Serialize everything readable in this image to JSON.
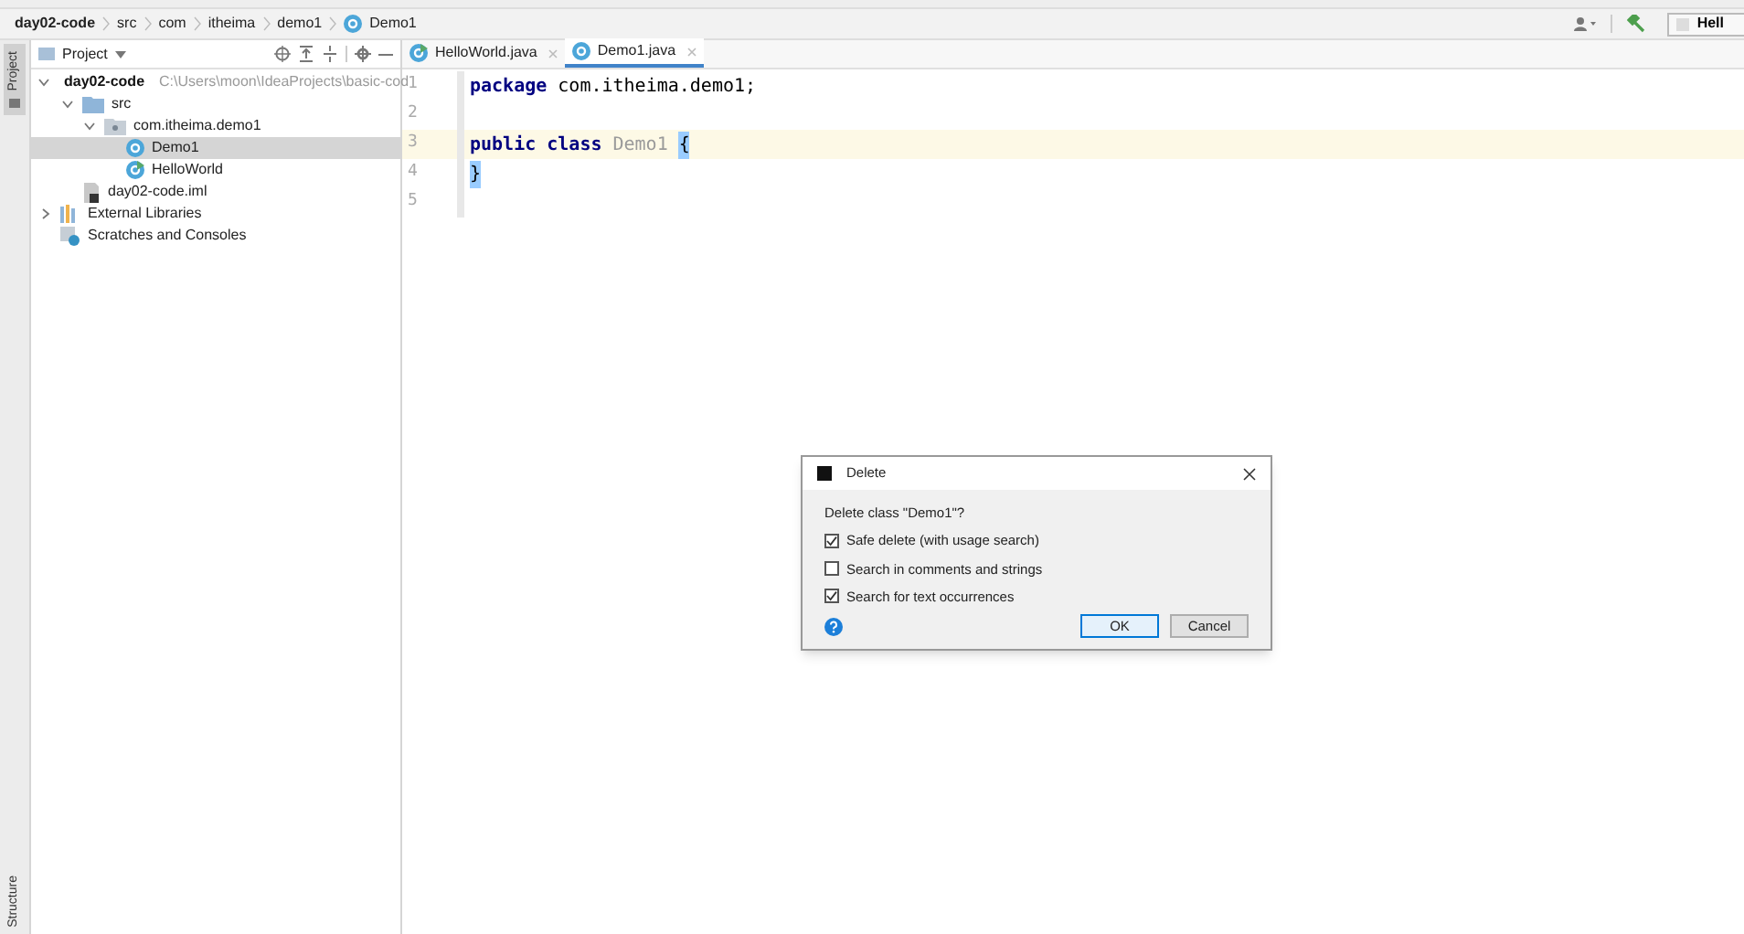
{
  "breadcrumbs": [
    {
      "label": "day02-code",
      "kind": "module"
    },
    {
      "label": "src",
      "kind": "folder"
    },
    {
      "label": "com",
      "kind": "folder"
    },
    {
      "label": "itheima",
      "kind": "folder"
    },
    {
      "label": "demo1",
      "kind": "folder"
    },
    {
      "label": "Demo1",
      "kind": "class"
    }
  ],
  "toolbar": {
    "run_config": "Hell"
  },
  "side_tabs": {
    "top": "Project",
    "bottom": "Structure"
  },
  "project_panel": {
    "title": "Project",
    "tree": [
      {
        "label": "day02-code",
        "path": "C:\\Users\\moon\\IdeaProjects\\basic-cod",
        "kind": "module",
        "expanded": true,
        "selected": false,
        "children": [
          {
            "label": "src",
            "kind": "folder",
            "expanded": true,
            "selected": false,
            "children": [
              {
                "label": "com.itheima.demo1",
                "kind": "package",
                "expanded": true,
                "selected": false,
                "children": [
                  {
                    "label": "Demo1",
                    "kind": "class",
                    "selected": true
                  },
                  {
                    "label": "HelloWorld",
                    "kind": "main",
                    "selected": false
                  }
                ]
              }
            ]
          },
          {
            "label": "day02-code.iml",
            "kind": "iml",
            "selected": false
          }
        ]
      },
      {
        "label": "External Libraries",
        "kind": "libs",
        "expanded": false,
        "selected": false
      },
      {
        "label": "Scratches and Consoles",
        "kind": "scratch",
        "selected": false
      }
    ]
  },
  "editor": {
    "tabs": [
      {
        "label": "HelloWorld.java",
        "kind": "main",
        "selected": false
      },
      {
        "label": "Demo1.java",
        "kind": "class",
        "selected": true
      }
    ],
    "lines": [
      {
        "number": "1",
        "current": false,
        "tokens": [
          {
            "text": "package",
            "kind": "keyword"
          },
          {
            "text": "com.itheima.demo1;",
            "kind": "plain"
          }
        ]
      },
      {
        "number": "2",
        "current": false
      },
      {
        "number": "3",
        "current": true,
        "tokens": [
          {
            "text": "public class",
            "kind": "keyword"
          },
          {
            "text": "Demo1",
            "kind": "unused"
          },
          {
            "text": "{",
            "kind": "brace"
          }
        ]
      },
      {
        "number": "4",
        "current": false,
        "tokens": [
          {
            "text": "}",
            "kind": "brace"
          }
        ]
      },
      {
        "number": "5",
        "current": false
      }
    ]
  },
  "dialog": {
    "title": "Delete",
    "message": "Delete class \"Demo1\"?",
    "options": [
      {
        "label": "Safe delete (with usage search)",
        "checked": true
      },
      {
        "label": "Search in comments and strings",
        "checked": false
      },
      {
        "label": "Search for text occurrences",
        "checked": true
      }
    ],
    "buttons": [
      {
        "label": "OK",
        "kind": "primary"
      },
      {
        "label": "Cancel",
        "kind": "secondary"
      }
    ]
  }
}
